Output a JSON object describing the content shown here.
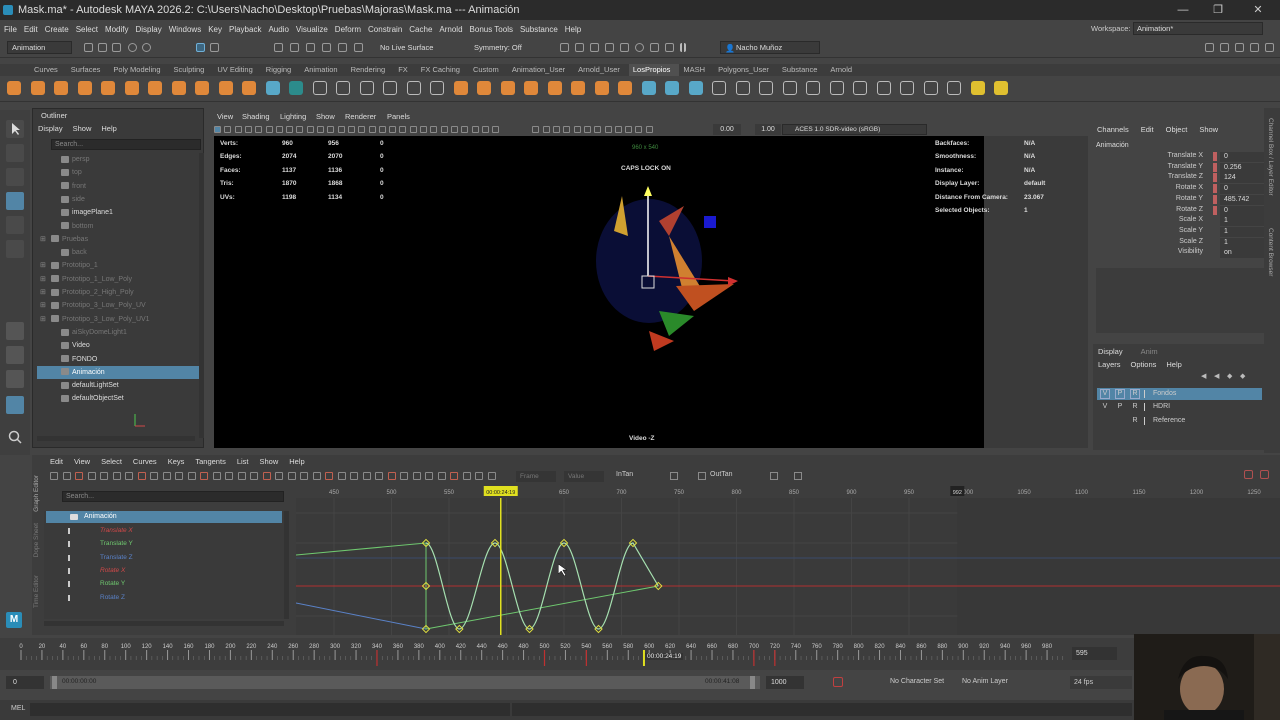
{
  "title": {
    "text": "Mask.ma* - Autodesk MAYA 2026.2: C:\\Users\\Nacho\\Desktop\\Pruebas\\Majoras\\Mask.ma  ---  Animación"
  },
  "menu": [
    "File",
    "Edit",
    "Create",
    "Select",
    "Modify",
    "Display",
    "Windows",
    "Key",
    "Playback",
    "Audio",
    "Visualize",
    "Deform",
    "Constrain",
    "Cache",
    "Arnold",
    "Bonus Tools",
    "Substance",
    "Help"
  ],
  "workspace": {
    "label": "Workspace:",
    "value": "Animation*"
  },
  "status": {
    "mode": "Animation",
    "live": "No Live Surface",
    "symmetry": "Symmetry: Off",
    "user": "Nacho Muñoz"
  },
  "shelf_tabs": [
    "Curves",
    "Surfaces",
    "Poly Modeling",
    "Sculpting",
    "UV Editing",
    "Rigging",
    "Animation",
    "Rendering",
    "FX",
    "FX Caching",
    "Custom",
    "Animation_User",
    "Arnold_User",
    "LosPropios",
    "MASH",
    "Polygons_User",
    "Substance",
    "Arnold"
  ],
  "shelf_active": "LosPropios",
  "outliner": {
    "title": "Outliner",
    "menu": [
      "Display",
      "Show",
      "Help"
    ],
    "search": "Search...",
    "items": [
      {
        "label": "persp",
        "dim": true,
        "indent": 1
      },
      {
        "label": "top",
        "dim": true,
        "indent": 1
      },
      {
        "label": "front",
        "dim": true,
        "indent": 1
      },
      {
        "label": "side",
        "dim": true,
        "indent": 1
      },
      {
        "label": "imagePlane1",
        "dim": false,
        "indent": 1
      },
      {
        "label": "bottom",
        "dim": true,
        "indent": 1
      },
      {
        "label": "Pruebas",
        "dim": true,
        "indent": 0
      },
      {
        "label": "back",
        "dim": true,
        "indent": 1
      },
      {
        "label": "Prototipo_1",
        "dim": true,
        "indent": 0
      },
      {
        "label": "Prototipo_1_Low_Poly",
        "dim": true,
        "indent": 0
      },
      {
        "label": "Prototipo_2_High_Poly",
        "dim": true,
        "indent": 0
      },
      {
        "label": "Prototipo_3_Low_Poly_UV",
        "dim": true,
        "indent": 0
      },
      {
        "label": "Prototipo_3_Low_Poly_UV1",
        "dim": true,
        "indent": 0
      },
      {
        "label": "aiSkyDomeLight1",
        "dim": true,
        "indent": 1
      },
      {
        "label": "Video",
        "dim": false,
        "indent": 1
      },
      {
        "label": "FONDO",
        "dim": false,
        "indent": 1
      },
      {
        "label": "Animación",
        "dim": false,
        "indent": 1,
        "selected": true
      },
      {
        "label": "defaultLightSet",
        "dim": false,
        "indent": 1
      },
      {
        "label": "defaultObjectSet",
        "dim": false,
        "indent": 1
      }
    ]
  },
  "viewport": {
    "menu": [
      "View",
      "Shading",
      "Lighting",
      "Show",
      "Renderer",
      "Panels"
    ],
    "exposure": "0.00",
    "gamma": "1.00",
    "colorspace": "ACES 1.0 SDR-video (sRGB)",
    "caps": "CAPS LOCK ON",
    "camera": "Video -Z",
    "resolution": "960 x 540",
    "stats": [
      {
        "k": "Verts:",
        "a": "960",
        "b": "956",
        "c": "0"
      },
      {
        "k": "Edges:",
        "a": "2074",
        "b": "2070",
        "c": "0"
      },
      {
        "k": "Faces:",
        "a": "1137",
        "b": "1136",
        "c": "0"
      },
      {
        "k": "Tris:",
        "a": "1870",
        "b": "1868",
        "c": "0"
      },
      {
        "k": "UVs:",
        "a": "1198",
        "b": "1134",
        "c": "0"
      }
    ],
    "info": [
      {
        "k": "Backfaces:",
        "v": "N/A"
      },
      {
        "k": "Smoothness:",
        "v": "N/A"
      },
      {
        "k": "Instance:",
        "v": "N/A"
      },
      {
        "k": "Display Layer:",
        "v": "default"
      },
      {
        "k": "Distance From Camera:",
        "v": "23.067"
      },
      {
        "k": "Selected Objects:",
        "v": "1"
      }
    ]
  },
  "channelbox": {
    "menu": [
      "Channels",
      "Edit",
      "Object",
      "Show"
    ],
    "object": "Animación",
    "channels": [
      {
        "k": "Translate X",
        "v": "0",
        "keyed": true
      },
      {
        "k": "Translate Y",
        "v": "0.256",
        "keyed": true
      },
      {
        "k": "Translate Z",
        "v": "124",
        "keyed": true
      },
      {
        "k": "Rotate X",
        "v": "0",
        "keyed": true
      },
      {
        "k": "Rotate Y",
        "v": "485.742",
        "keyed": true
      },
      {
        "k": "Rotate Z",
        "v": "0",
        "keyed": true
      },
      {
        "k": "Scale X",
        "v": "1",
        "keyed": false
      },
      {
        "k": "Scale Y",
        "v": "1",
        "keyed": false
      },
      {
        "k": "Scale Z",
        "v": "1",
        "keyed": false
      },
      {
        "k": "Visibility",
        "v": "on",
        "keyed": false
      }
    ]
  },
  "layers": {
    "tabs": [
      "Display",
      "Anim"
    ],
    "menu": [
      "Layers",
      "Options",
      "Help"
    ],
    "rows": [
      {
        "v": "V",
        "p": "P",
        "r": "R",
        "name": "Fondos",
        "selected": true
      },
      {
        "v": "V",
        "p": "P",
        "r": "R",
        "name": "HDRI",
        "selected": false
      },
      {
        "v": "",
        "p": "",
        "r": "R",
        "name": "Reference",
        "selected": false
      }
    ]
  },
  "side_tabs": [
    "Channel Box / Layer Editor",
    "Content Browser"
  ],
  "graph": {
    "menu": [
      "Edit",
      "View",
      "Select",
      "Curves",
      "Keys",
      "Tangents",
      "List",
      "Show",
      "Help"
    ],
    "search": "Search...",
    "frame_label": "Frame",
    "value_label": "Value",
    "intan": "InTan",
    "outtan": "OutTan",
    "node": "Animación",
    "channels": [
      {
        "label": "Translate X",
        "color": "#d04848"
      },
      {
        "label": "Translate Y",
        "color": "#6fc86f"
      },
      {
        "label": "Translate Z",
        "color": "#5a82c8"
      },
      {
        "label": "Rotate X",
        "color": "#d04848"
      },
      {
        "label": "Rotate Y",
        "color": "#6fc86f"
      },
      {
        "label": "Rotate Z",
        "color": "#5a82c8"
      }
    ],
    "side_labels": [
      "Graph Editor",
      "Dope Sheet",
      "Time Editor"
    ],
    "ruler": [
      "450",
      "500",
      "550",
      "600",
      "650",
      "700",
      "750",
      "800",
      "850",
      "900",
      "950",
      "1000",
      "1050",
      "1100",
      "1150",
      "1200",
      "1250"
    ],
    "ruler_start": 450,
    "ruler_step": 50,
    "current_time": "00:00:24:19",
    "current_frame": 595,
    "end_marker": "992"
  },
  "timeslider": {
    "ticks": [
      "0",
      "20",
      "40",
      "60",
      "80",
      "100",
      "120",
      "140",
      "160",
      "180",
      "200",
      "220",
      "240",
      "260",
      "280",
      "300",
      "320",
      "340",
      "360",
      "380",
      "400",
      "420",
      "440",
      "460",
      "480",
      "500",
      "520",
      "540",
      "560",
      "580",
      "600",
      "620",
      "640",
      "660",
      "680",
      "700",
      "720",
      "740",
      "760",
      "780",
      "800",
      "820",
      "840",
      "860",
      "880",
      "900",
      "920",
      "940",
      "960",
      "980"
    ],
    "current": "00:00:24:19",
    "frame_field": "595"
  },
  "range": {
    "start": "0",
    "start_time": "00:00:00:00",
    "end_time": "00:00:41:08",
    "end": "1000",
    "charset": "No Character Set",
    "animlayer": "No Anim Layer",
    "fps": "24 fps"
  },
  "cmd": {
    "label": "MEL"
  }
}
